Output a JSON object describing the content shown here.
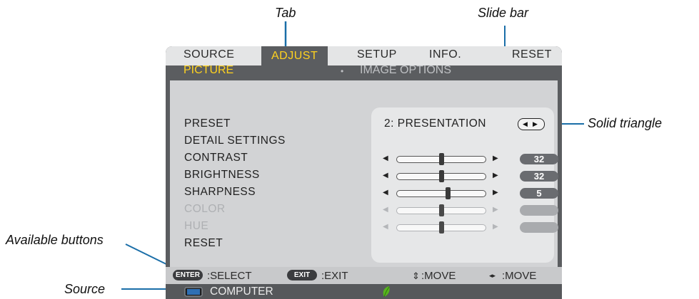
{
  "callouts": {
    "tab": "Tab",
    "slide_bar": "Slide bar",
    "solid_triangle": "Solid triangle",
    "available_buttons": "Available buttons",
    "source": "Source"
  },
  "tabs": [
    "SOURCE",
    "ADJUST",
    "SETUP",
    "INFO.",
    "RESET"
  ],
  "active_tab": "ADJUST",
  "subtabs": {
    "active": "PICTURE",
    "other_bullet": "•",
    "other": "IMAGE OPTIONS"
  },
  "items": [
    {
      "label": "PRESET",
      "enabled": true
    },
    {
      "label": "DETAIL SETTINGS",
      "enabled": true
    },
    {
      "label": "CONTRAST",
      "enabled": true,
      "value": "32",
      "level": 0.5
    },
    {
      "label": "BRIGHTNESS",
      "enabled": true,
      "value": "32",
      "level": 0.5
    },
    {
      "label": "SHARPNESS",
      "enabled": true,
      "value": "5",
      "level": 0.58
    },
    {
      "label": "COLOR",
      "enabled": false,
      "value": "",
      "level": 0.5
    },
    {
      "label": "HUE",
      "enabled": false,
      "value": "",
      "level": 0.5
    },
    {
      "label": "RESET",
      "enabled": true
    }
  ],
  "preset_value": "2:  PRESENTATION",
  "hints": {
    "enter_key": "ENTER",
    "enter_text": ":SELECT",
    "exit_key": "EXIT",
    "exit_text": ":EXIT",
    "updown_icon": "⇕",
    "updown_text": ":MOVE",
    "leftright_icon": "◂▸",
    "leftright_text": ":MOVE"
  },
  "source_bar": {
    "icon": "computer-icon",
    "label": "COMPUTER",
    "eco_icon": "leaf-icon"
  },
  "colors": {
    "menu_bg": "#5b5d60",
    "active_yellow": "#ffd21f",
    "eco_green": "#58b51e"
  }
}
